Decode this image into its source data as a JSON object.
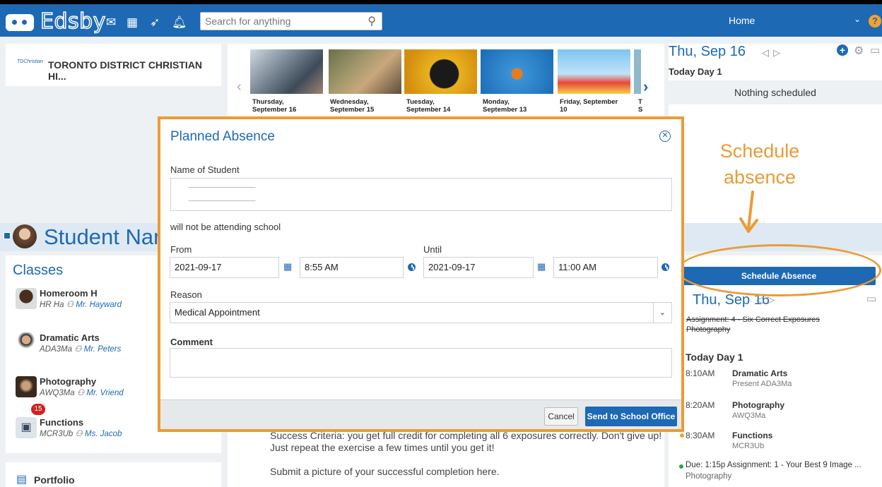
{
  "topbar": {
    "brand": "Edsby",
    "search_placeholder": "Search for anything",
    "home_label": "Home",
    "help_label": "?"
  },
  "school": {
    "name": "TORONTO DISTRICT CHRISTIAN HI...",
    "logo_text": "TDChristian"
  },
  "carousel": {
    "items": [
      {
        "day": "Thursday,",
        "date": "September 16"
      },
      {
        "day": "Wednesday,",
        "date": "September 15"
      },
      {
        "day": "Tuesday,",
        "date": "September 14"
      },
      {
        "day": "Monday,",
        "date": "September 13"
      },
      {
        "day": "Friday, September",
        "date": "10"
      },
      {
        "day": "T",
        "date": "S"
      }
    ]
  },
  "calendar_top": {
    "date": "Thu, Sep 16",
    "today": "Today  Day 1",
    "nothing": "Nothing scheduled"
  },
  "student": {
    "name": "Student Name"
  },
  "classes": {
    "heading": "Classes",
    "items": [
      {
        "name": "Homeroom H",
        "code": "HR Ha",
        "teacher": "Mr. Hayward"
      },
      {
        "name": "Dramatic Arts",
        "code": "ADA3Ma",
        "teacher": "Mr. Peters"
      },
      {
        "name": "Photography",
        "code": "AWQ3Ma",
        "teacher": "Mr. Vriend"
      },
      {
        "name": "Functions",
        "code": "MCR3Ub",
        "teacher": "Ms. Jacob",
        "badge": "15"
      }
    ]
  },
  "portfolio": {
    "label": "Portfolio"
  },
  "feed": {
    "line1": "Success Criteria: you get full credit for completing all 6 exposures correctly. Don't give up!",
    "line2": "Just repeat the exercise a few times until you get it!",
    "line3": "Submit a picture of your successful completion here."
  },
  "calendar_bottom": {
    "schedule_button": "Schedule Absence",
    "date": "Thu, Sep 16",
    "assignment": "Assignment: 4 - Six Correct Exposures Photography",
    "today": "Today  Day 1",
    "events": [
      {
        "time": "8:10AM",
        "name": "Dramatic Arts",
        "sub": "Present ADA3Ma"
      },
      {
        "time": "8:20AM",
        "name": "Photography",
        "sub": "AWQ3Ma"
      },
      {
        "time": "8:30AM",
        "name": "Functions",
        "sub": "MCR3Ub"
      }
    ],
    "due": "Due: 1:15p Assignment: 1 - Your Best 9 Image ...",
    "due_sub": "Photography"
  },
  "annotation": {
    "line1": "Schedule",
    "line2": "absence",
    "color": "#eb9b35"
  },
  "modal": {
    "title": "Planned Absence",
    "name_label": "Name of Student",
    "sentence": "will not be attending school",
    "from_label": "From",
    "until_label": "Until",
    "from_date": "2021-09-17",
    "from_time": "8:55 AM",
    "until_date": "2021-09-17",
    "until_time": "11:00 AM",
    "reason_label": "Reason",
    "reason_value": "Medical Appointment",
    "comment_label": "Comment",
    "cancel": "Cancel",
    "send": "Send to School Office"
  },
  "colors": {
    "brand_blue": "#1d69b4",
    "accent_orange": "#eb9b35"
  }
}
